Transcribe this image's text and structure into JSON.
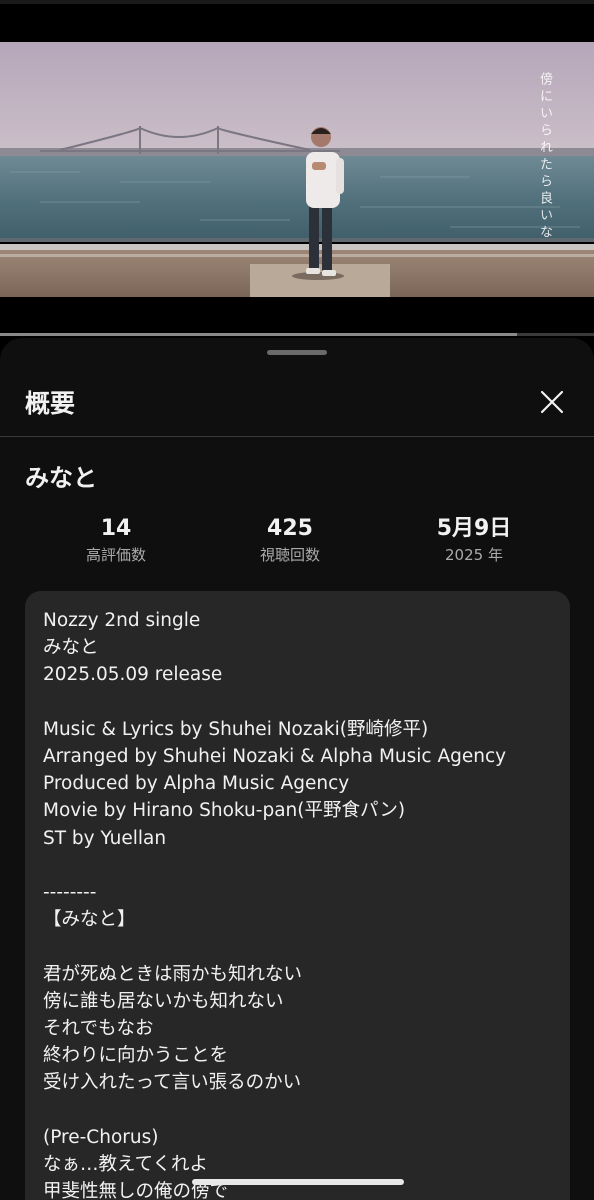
{
  "video": {
    "overlay_caption": "傍にいられたら良いな",
    "progress": 0.87
  },
  "sheet": {
    "title": "概要",
    "close_icon": "close-icon",
    "video_title": "みなと",
    "stats": [
      {
        "value": "14",
        "label": "高評価数"
      },
      {
        "value": "425",
        "label": "視聴回数"
      },
      {
        "value": "5月9日",
        "label": "2025 年"
      }
    ],
    "description": "Nozzy 2nd single\nみなと\n2025.05.09 release\n\nMusic & Lyrics by Shuhei Nozaki(野崎修平)\nArranged by Shuhei Nozaki & Alpha Music Agency\nProduced by Alpha Music Agency\nMovie by Hirano Shoku-pan(平野食パン)\nST by Yuellan\n\n--------\n【みなと】\n\n君が死ぬときは雨かも知れない\n傍に誰も居ないかも知れない\nそれでもなお\n終わりに向かうことを\n受け入れたって言い張るのかい\n\n(Pre-Chorus)\nなぁ…教えてくれよ\n甲斐性無しの俺の傍で"
  },
  "colors": {
    "sheet_bg": "#0f0f0f",
    "card_bg": "#272727",
    "text_primary": "#f1f1f1",
    "text_secondary": "#aaaaaa"
  }
}
